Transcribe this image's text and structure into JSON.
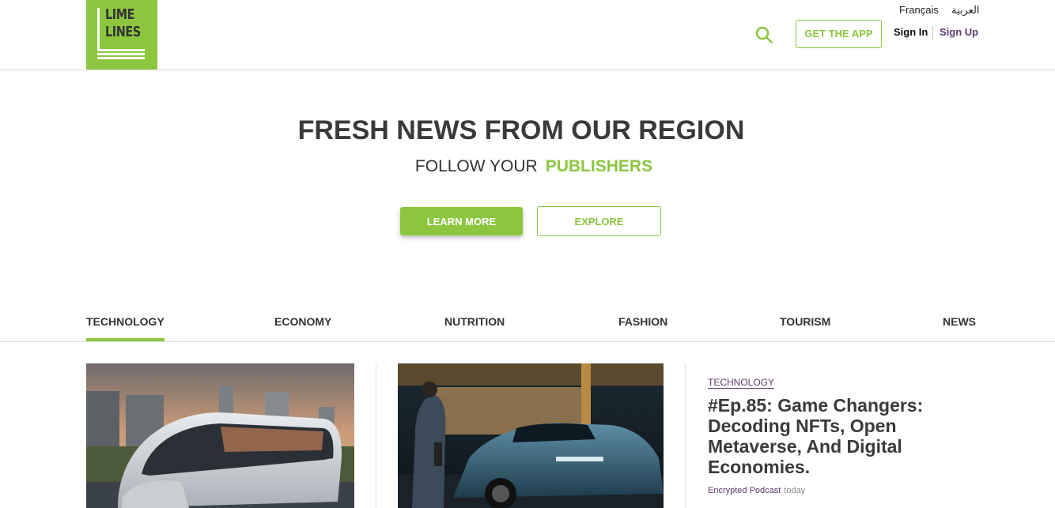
{
  "header": {
    "logo": {
      "line1": "LIME",
      "line2": "LINES"
    },
    "languages": [
      "Français",
      "العربية"
    ],
    "search_icon": "search-icon",
    "get_app_label": "GET THE APP",
    "sign_in_label": "Sign In",
    "sign_up_label": "Sign Up"
  },
  "hero": {
    "title": "FRESH NEWS FROM OUR REGION",
    "subtitle_prefix": "FOLLOW YOUR",
    "subtitle_accent": "PUBLISHERS",
    "learn_more_label": "LEARN MORE",
    "explore_label": "EXPLORE"
  },
  "tabs": [
    {
      "label": "TECHNOLOGY",
      "active": true
    },
    {
      "label": "ECONOMY",
      "active": false
    },
    {
      "label": "NUTRITION",
      "active": false
    },
    {
      "label": "FASHION",
      "active": false
    },
    {
      "label": "TOURISM",
      "active": false
    },
    {
      "label": "NEWS",
      "active": false
    }
  ],
  "articles": [
    {
      "image": "futuristic-train-image"
    },
    {
      "image": "electric-car-charging-image"
    },
    {
      "category": "TECHNOLOGY",
      "title": "#Ep.85: Game Changers: Decoding NFTs, Open Metaverse, And Digital Economies.",
      "source": "Encrypted Podcast",
      "time": "today"
    }
  ],
  "colors": {
    "accent": "#8cc63f",
    "link": "#5c3a6e",
    "text": "#333333"
  }
}
